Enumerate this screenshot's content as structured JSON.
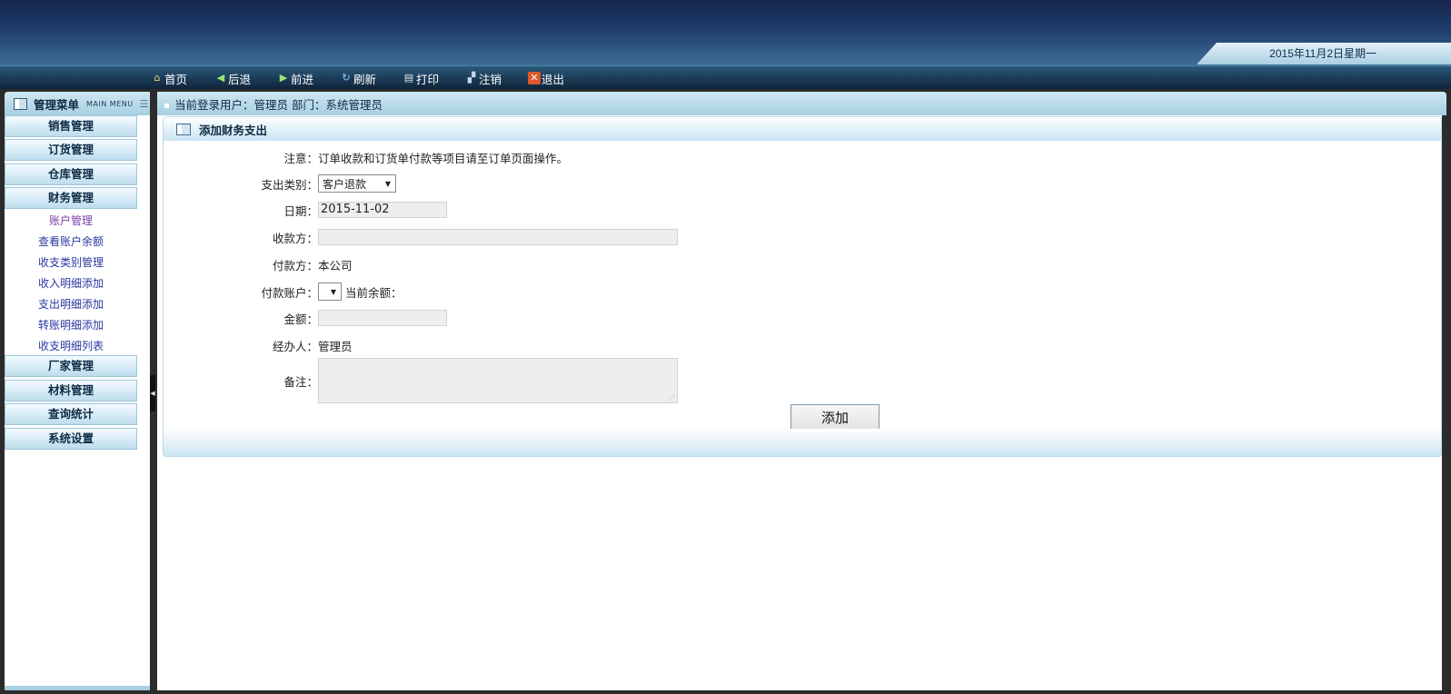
{
  "header": {
    "date_text": "2015年11月2日星期一"
  },
  "toolbar": {
    "home": "首页",
    "back": "后退",
    "forward": "前进",
    "refresh": "刷新",
    "print": "打印",
    "logout": "注销",
    "exit": "退出"
  },
  "sidebar": {
    "title": "管理菜单",
    "subtitle": "MAIN MENU",
    "categories": {
      "sales": "销售管理",
      "orders": "订货管理",
      "warehouse": "仓库管理",
      "finance": "财务管理",
      "manufacturer": "厂家管理",
      "materials": "材料管理",
      "query": "查询统计",
      "settings": "系统设置"
    },
    "finance_items": [
      "账户管理",
      "查看账户余额",
      "收支类别管理",
      "收入明细添加",
      "支出明细添加",
      "转账明细添加",
      "收支明细列表"
    ]
  },
  "breadcrumb": {
    "text": "当前登录用户：管理员 部门：系统管理员"
  },
  "form": {
    "title": "添加财务支出",
    "note_label": "注意：",
    "note_text": "订单收款和订货单付款等项目请至订单页面操作。",
    "category_label": "支出类别：",
    "category_value": "客户退款",
    "date_label": "日期：",
    "date_value": "2015-11-02",
    "payee_label": "收款方：",
    "payee_value": "",
    "payer_label": "付款方：",
    "payer_value": "本公司",
    "account_label": "付款账户：",
    "account_value": "",
    "balance_label": "当前余额：",
    "amount_label": "金额：",
    "amount_value": "",
    "handler_label": "经办人：",
    "handler_value": "管理员",
    "remarks_label": "备注：",
    "remarks_value": "",
    "submit_label": "添加"
  }
}
